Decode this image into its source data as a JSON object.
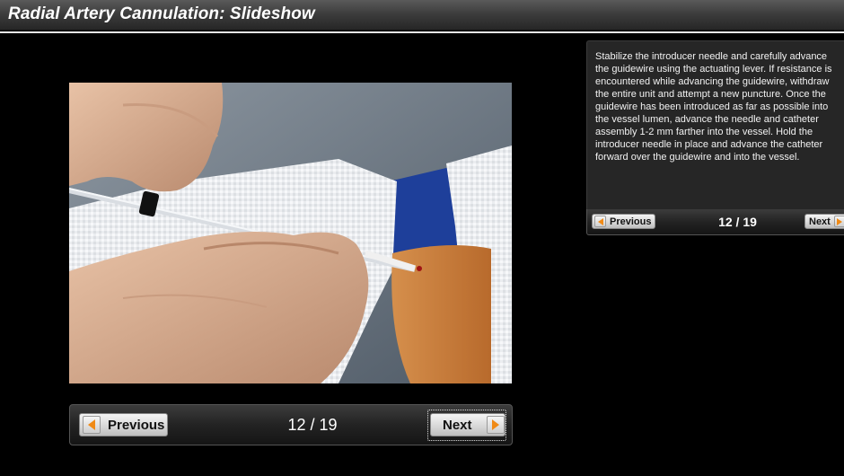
{
  "title": "Radial Artery Cannulation: Slideshow",
  "slide": {
    "caption": "Stabilize the introducer needle and carefully advance the guidewire using the actuating lever. If resistance is encountered while advancing the guidewire, withdraw the entire unit and attempt a new puncture. Once the guidewire has been introduced as far as possible into the vessel lumen, advance the needle and catheter assembly 1-2 mm farther into the vessel. Hold the introducer needle in place and advance the catheter forward over the guidewire and into the vessel.",
    "counter": "12 / 19"
  },
  "nav": {
    "previous_label": "Previous",
    "next_label": "Next"
  },
  "icons": {
    "previous": "arrow-left-icon",
    "next": "arrow-right-icon"
  },
  "colors": {
    "accent_arrow": "#f08a16",
    "background": "#000000",
    "title_text": "#ffffff"
  }
}
